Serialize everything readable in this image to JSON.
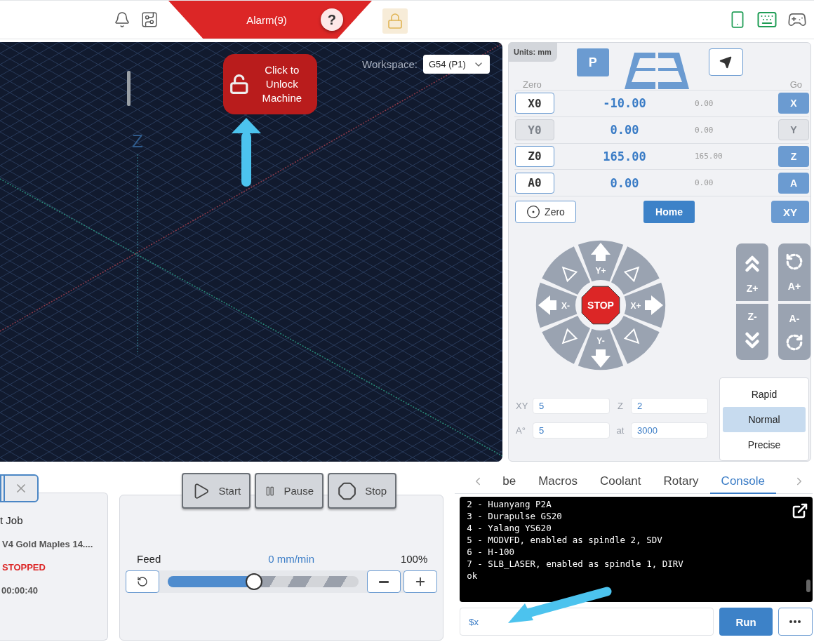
{
  "top_bar": {
    "alarm": {
      "label": "Alarm(9)",
      "help": "?"
    }
  },
  "visualizer": {
    "axis_label": "Z",
    "unlock_button": "Click to Unlock Machine",
    "workspace": {
      "label": "Workspace:",
      "value": "G54 (P1)"
    }
  },
  "position": {
    "units": "Units: mm",
    "p_button": "P",
    "zero_header": "Zero",
    "go_header": "Go",
    "axes": [
      {
        "zero": "X0",
        "value": "-10.00",
        "machine": "0.00",
        "go": "X",
        "disabled": false
      },
      {
        "zero": "Y0",
        "value": "0.00",
        "machine": "0.00",
        "go": "Y",
        "disabled": true
      },
      {
        "zero": "Z0",
        "value": "165.00",
        "machine": "165.00",
        "go": "Z",
        "disabled": false
      },
      {
        "zero": "A0",
        "value": "0.00",
        "machine": "0.00",
        "go": "A",
        "disabled": false
      }
    ],
    "zero_button": "Zero",
    "home_button": "Home",
    "xy_button": "XY"
  },
  "jog": {
    "stop": "STOP",
    "directions": [
      {
        "kind": "arrow",
        "label": "Y+"
      },
      {
        "kind": "diagonal"
      },
      {
        "kind": "arrow",
        "label": "X+"
      },
      {
        "kind": "diagonal"
      },
      {
        "kind": "arrow",
        "label": "Y-"
      },
      {
        "kind": "diagonal"
      },
      {
        "kind": "arrow",
        "label": "X-"
      },
      {
        "kind": "diagonal"
      }
    ],
    "side": [
      {
        "kind": "z_up",
        "label": "Z+"
      },
      {
        "kind": "z_down",
        "label": "Z-"
      },
      {
        "kind": "a_up",
        "label": "A+"
      },
      {
        "kind": "a_down",
        "label": "A-"
      }
    ]
  },
  "steps": [
    {
      "label": "XY",
      "value": "5"
    },
    {
      "label": "Z",
      "value": "2"
    },
    {
      "label": "A°",
      "value": "5"
    },
    {
      "label": "at",
      "value": "3000"
    }
  ],
  "speeds": [
    {
      "label": "Rapid",
      "selected": false
    },
    {
      "label": "Normal",
      "selected": true
    },
    {
      "label": "Precise",
      "selected": false
    }
  ],
  "job": {
    "title": "t Job",
    "file": "V4 Gold Maples 14....",
    "status": "STOPPED",
    "elapsed": "00:00:40"
  },
  "run_controls": [
    {
      "kind": "start",
      "label": "Start"
    },
    {
      "kind": "pause",
      "label": "Pause"
    },
    {
      "kind": "stop",
      "label": "Stop"
    }
  ],
  "feed": {
    "label": "Feed",
    "rate": "0 mm/min",
    "percent": "100%",
    "level": 0.45
  },
  "console": {
    "tabs": [
      {
        "label": "be",
        "selected": false
      },
      {
        "label": "Macros",
        "selected": false
      },
      {
        "label": "Coolant",
        "selected": false
      },
      {
        "label": "Rotary",
        "selected": false
      },
      {
        "label": "Console",
        "selected": true
      }
    ],
    "lines": [
      "2 - Huanyang P2A",
      "3 - Durapulse GS20",
      "4 - Yalang YS620",
      "5 - MODVFD, enabled as spindle 2, SDV",
      "6 - H-100",
      "7 - SLB_LASER, enabled as spindle 1, DIRV",
      "ok"
    ],
    "input": "$x",
    "run": "Run"
  }
}
